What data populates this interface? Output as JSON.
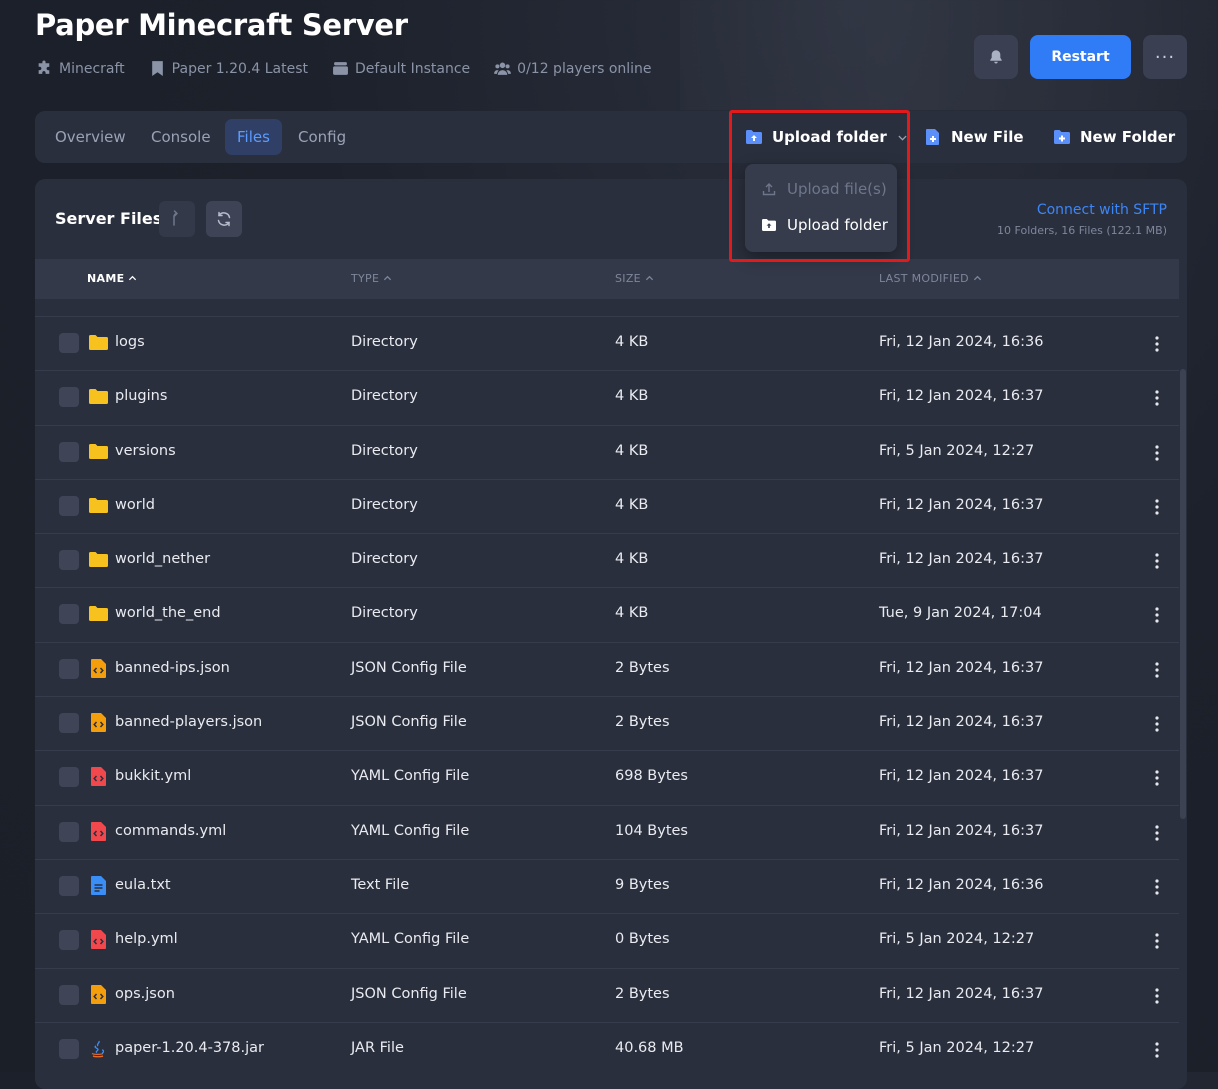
{
  "header": {
    "title": "Paper Minecraft Server",
    "meta": [
      {
        "icon": "puzzle-icon",
        "text": "Minecraft"
      },
      {
        "icon": "bookmark-icon",
        "text": "Paper 1.20.4 Latest"
      },
      {
        "icon": "server-icon",
        "text": "Default Instance"
      },
      {
        "icon": "users-icon",
        "text": "0/12 players online"
      }
    ],
    "restart_label": "Restart",
    "more_label": "···"
  },
  "tabs": [
    "Overview",
    "Console",
    "Files",
    "Config"
  ],
  "active_tab": "Files",
  "actions": {
    "upload_folder": "Upload folder",
    "new_file": "New File",
    "new_folder": "New Folder"
  },
  "upload_menu": {
    "upload_files": "Upload file(s)",
    "upload_folder": "Upload folder"
  },
  "files_panel": {
    "title": "Server Files",
    "sftp_link": "Connect with SFTP",
    "summary": "10 Folders, 16 Files (122.1 MB)"
  },
  "columns": [
    "NAME",
    "TYPE",
    "SIZE",
    "LAST MODIFIED"
  ],
  "rows": [
    {
      "name": "logs",
      "type": "Directory",
      "size": "4 KB",
      "modified": "Fri, 12 Jan 2024, 16:36",
      "icon": "folder"
    },
    {
      "name": "plugins",
      "type": "Directory",
      "size": "4 KB",
      "modified": "Fri, 12 Jan 2024, 16:37",
      "icon": "folder"
    },
    {
      "name": "versions",
      "type": "Directory",
      "size": "4 KB",
      "modified": "Fri, 5 Jan 2024, 12:27",
      "icon": "folder"
    },
    {
      "name": "world",
      "type": "Directory",
      "size": "4 KB",
      "modified": "Fri, 12 Jan 2024, 16:37",
      "icon": "folder"
    },
    {
      "name": "world_nether",
      "type": "Directory",
      "size": "4 KB",
      "modified": "Fri, 12 Jan 2024, 16:37",
      "icon": "folder"
    },
    {
      "name": "world_the_end",
      "type": "Directory",
      "size": "4 KB",
      "modified": "Tue, 9 Jan 2024, 17:04",
      "icon": "folder"
    },
    {
      "name": "banned-ips.json",
      "type": "JSON Config File",
      "size": "2 Bytes",
      "modified": "Fri, 12 Jan 2024, 16:37",
      "icon": "json"
    },
    {
      "name": "banned-players.json",
      "type": "JSON Config File",
      "size": "2 Bytes",
      "modified": "Fri, 12 Jan 2024, 16:37",
      "icon": "json"
    },
    {
      "name": "bukkit.yml",
      "type": "YAML Config File",
      "size": "698 Bytes",
      "modified": "Fri, 12 Jan 2024, 16:37",
      "icon": "yaml"
    },
    {
      "name": "commands.yml",
      "type": "YAML Config File",
      "size": "104 Bytes",
      "modified": "Fri, 12 Jan 2024, 16:37",
      "icon": "yaml"
    },
    {
      "name": "eula.txt",
      "type": "Text File",
      "size": "9 Bytes",
      "modified": "Fri, 12 Jan 2024, 16:36",
      "icon": "text"
    },
    {
      "name": "help.yml",
      "type": "YAML Config File",
      "size": "0 Bytes",
      "modified": "Fri, 5 Jan 2024, 12:27",
      "icon": "yaml"
    },
    {
      "name": "ops.json",
      "type": "JSON Config File",
      "size": "2 Bytes",
      "modified": "Fri, 12 Jan 2024, 16:37",
      "icon": "json"
    },
    {
      "name": "paper-1.20.4-378.jar",
      "type": "JAR File",
      "size": "40.68 MB",
      "modified": "Fri, 5 Jan 2024, 12:27",
      "icon": "jar"
    }
  ],
  "colors": {
    "accent": "#2f7cf6",
    "folder": "#f7c21d",
    "json": "#f59e0b",
    "yaml": "#f0484d",
    "text": "#3b8ef6",
    "highlight": "#e11b1b"
  }
}
